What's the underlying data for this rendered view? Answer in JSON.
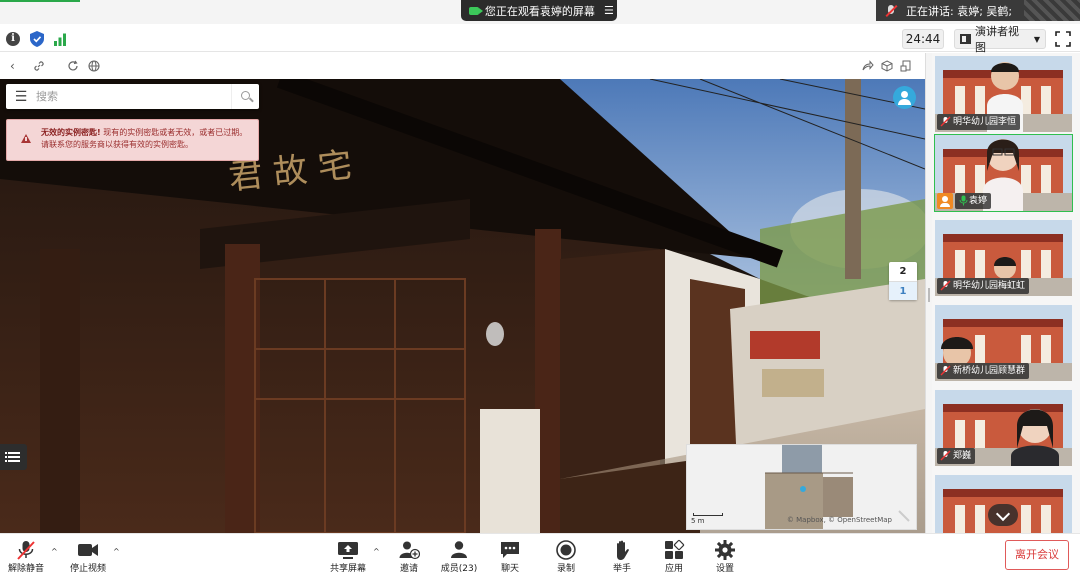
{
  "topbar": {
    "viewing_text": "您正在观看袁婷的屏幕",
    "speaking_text": "正在讲话: 袁婷; 吴鹤;"
  },
  "secondbar": {
    "timer": "24:44",
    "view_mode": "演讲者视图"
  },
  "shared": {
    "search_placeholder": "搜索",
    "error_title": "无效的实例密匙!",
    "error_body": "现有的实例密匙或者无效，或者已过期。请联系您的服务商以获得有效的实例密匙。",
    "floors": [
      "2",
      "1"
    ],
    "active_floor": "1",
    "scale_label": "5 m",
    "map_attribution": "© Mapbox, © OpenStreetMap"
  },
  "participants": [
    {
      "name": "明华幼儿园李恒",
      "muted": true
    },
    {
      "name": "袁婷",
      "muted": false,
      "host": true,
      "active": true
    },
    {
      "name": "明华幼儿园梅虹虹",
      "muted": true
    },
    {
      "name": "新桥幼儿园顾慧群",
      "muted": true
    },
    {
      "name": "郑巍",
      "muted": true
    }
  ],
  "toolbar": {
    "unmute": "解除静音",
    "stop_video": "停止视频",
    "share_screen": "共享屏幕",
    "invite": "邀请",
    "members": "成员(23)",
    "chat": "聊天",
    "record": "录制",
    "raise_hand": "举手",
    "apps": "应用",
    "settings": "设置",
    "leave": "离开会议"
  },
  "colors": {
    "active_speaker": "#2fbf4f",
    "leave": "#d93a3a",
    "viewing_pill": "#2b2b2b",
    "error_bg": "#f4d6d6"
  }
}
